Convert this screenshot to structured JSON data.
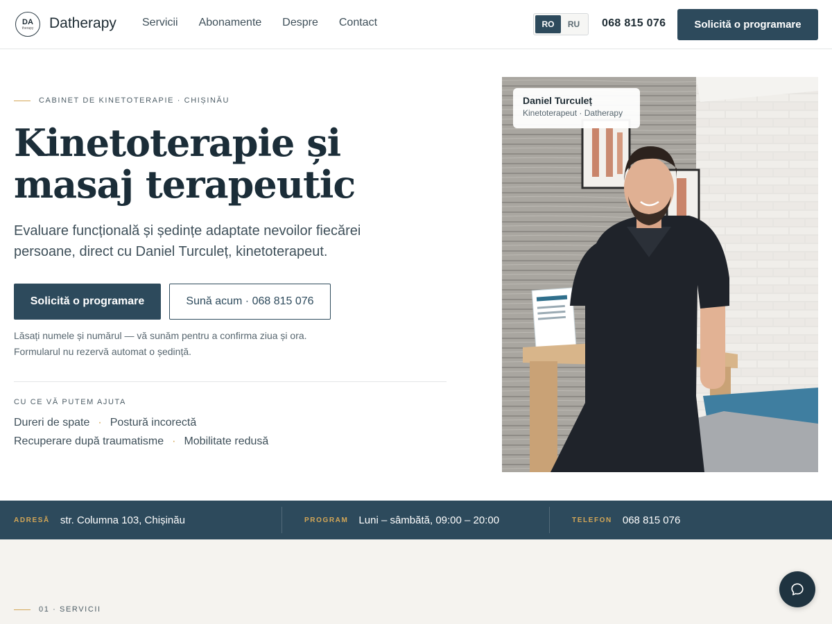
{
  "header": {
    "logo_mark": "DA",
    "logo_sub": "therapy",
    "brand": "Datherapy",
    "nav": [
      "Servicii",
      "Abonamente",
      "Despre",
      "Contact"
    ],
    "lang": {
      "ro": "RO",
      "ru": "RU",
      "active": "RO"
    },
    "phone": "068 815 076",
    "cta": "Solicită o programare"
  },
  "hero": {
    "eyebrow": "CABINET DE KINETOTERAPIE · CHIȘINĂU",
    "title_line1": "Kinetoterapie și",
    "title_line2": "masaj terapeutic",
    "description": "Evaluare funcțională și ședințe adaptate nevoilor fiecărei persoane, direct cu Daniel Turculeț, kinetoterapeut.",
    "primary_button": "Solicită o programare",
    "secondary_button": "Sună acum · 068 815 076",
    "note_line1": "Lăsați numele și numărul — vă sunăm pentru a confirma ziua și ora.",
    "note_line2": "Formularul nu rezervă automat o ședință.",
    "help_heading": "CU CE VĂ PUTEM AJUTA",
    "help_items": [
      "Dureri de spate",
      "Postură incorectă",
      "Recuperare după traumatisme",
      "Mobilitate redusă"
    ]
  },
  "photo_card": {
    "name": "Daniel Turculeț",
    "role": "Kinetoterapeut · Datherapy"
  },
  "info_band": {
    "address_label": "ADRESĂ",
    "address_value": "str. Columna 103, Chișinău",
    "schedule_label": "PROGRAM",
    "schedule_value": "Luni – sâmbătă, 09:00 – 20:00",
    "phone_label": "TELEFON",
    "phone_value": "068 815 076"
  },
  "services_section": {
    "eyebrow": "01 · SERVICII"
  },
  "colors": {
    "accent": "#2d4a5c",
    "gold": "#d4a757",
    "text": "#1d2b33",
    "section_bg": "#f5f3ef"
  },
  "icons": {
    "chat": "chat-bubble-icon"
  }
}
